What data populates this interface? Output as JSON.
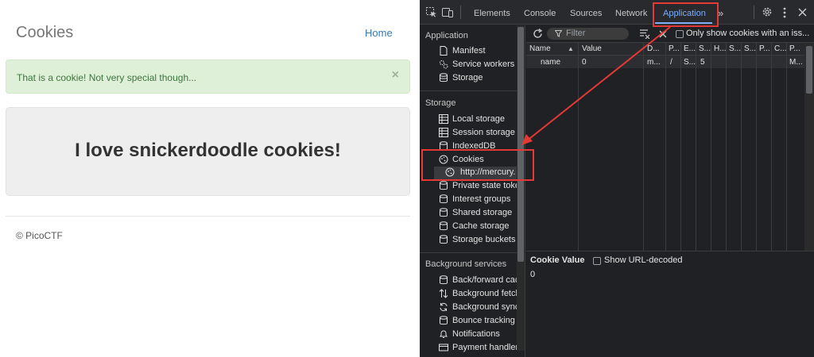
{
  "page": {
    "site_title": "Cookies",
    "home_link": "Home",
    "alert_text": "That is a cookie! Not very special though...",
    "alert_close": "×",
    "headline": "I love snickerdoodle cookies!",
    "footer": "© PicoCTF"
  },
  "devtools": {
    "tabs": [
      "Elements",
      "Console",
      "Sources",
      "Network",
      "Application"
    ],
    "active_tab": "Application",
    "more_tabs": "»",
    "settings_icon": "gear-icon",
    "menu_icon": "kebab-icon",
    "close_icon": "close-icon",
    "sidebar": {
      "section_application": "Application",
      "application_items": [
        "Manifest",
        "Service workers",
        "Storage"
      ],
      "section_storage": "Storage",
      "storage_items": [
        "Local storage",
        "Session storage",
        "IndexedDB",
        "Cookies",
        "http://mercury.",
        "Private state toke",
        "Interest groups",
        "Shared storage",
        "Cache storage",
        "Storage buckets"
      ],
      "section_background": "Background services",
      "background_items": [
        "Back/forward cac",
        "Background fetch",
        "Background sync",
        "Bounce tracking r",
        "Notifications",
        "Payment handler"
      ]
    },
    "cookies_toolbar": {
      "filter_placeholder": "Filter",
      "only_issues_label": "Only show cookies with an iss..."
    },
    "table": {
      "headers": [
        "Name",
        "Value",
        "D...",
        "P...",
        "E...",
        "S...",
        "H...",
        "S...",
        "S...",
        "P...",
        "C...",
        "P..."
      ],
      "rows": [
        [
          "name",
          "0",
          "m...",
          "/",
          "S...",
          "5",
          "",
          "",
          "",
          "",
          "",
          "M..."
        ]
      ]
    },
    "cookie_value_panel": {
      "title": "Cookie Value",
      "show_decoded_label": "Show URL-decoded",
      "value": "0"
    }
  },
  "colors": {
    "annotation": "#e53935",
    "accent": "#7cacf8"
  }
}
